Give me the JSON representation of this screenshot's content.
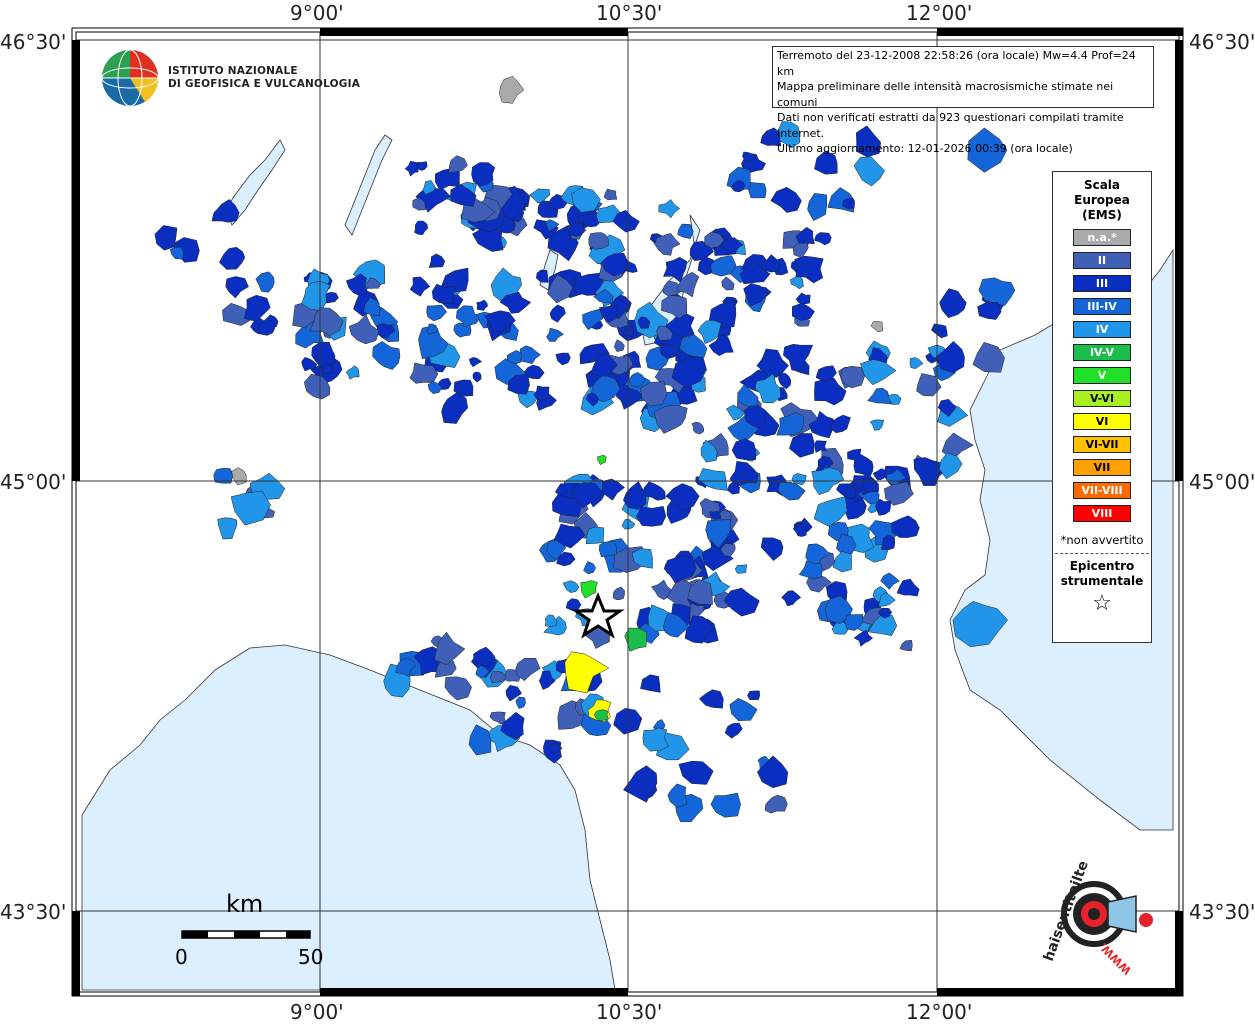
{
  "map": {
    "info_lines": [
      "Terremoto del 23-12-2008 22:58:26 (ora locale) Mw=4.4 Prof=24 km",
      "Mappa preliminare delle intensità macrosismiche stimate nei comuni",
      "Dati non verificati estratti da 923 questionari compilati tramite Internet.",
      "Ultimo aggiornamento: 12-01-2026 00:39 (ora locale)"
    ],
    "logo": {
      "line1": "ISTITUTO NAZIONALE",
      "line2": "DI GEOFISICA E VULCANOLOGIA"
    },
    "ticks": {
      "top": [
        "9°00'",
        "10°30'",
        "12°00'"
      ],
      "bottom": [
        "9°00'",
        "10°30'",
        "12°00'"
      ],
      "left": [
        "46°30'",
        "45°00'",
        "43°30'"
      ],
      "right": [
        "46°30'",
        "45°00'",
        "43°30'"
      ]
    },
    "scale": {
      "unit": "km",
      "start": "0",
      "end": "50"
    },
    "legend": {
      "title_lines": [
        "Scala",
        "Europea",
        "(EMS)"
      ],
      "classes": [
        {
          "label": "n.a.*",
          "color": "#aaaaaa"
        },
        {
          "label": "II",
          "color": "#4060b8"
        },
        {
          "label": "III",
          "color": "#0a2fc0"
        },
        {
          "label": "III-IV",
          "color": "#1466d8"
        },
        {
          "label": "IV",
          "color": "#2196e8"
        },
        {
          "label": "IV-V",
          "color": "#1bbe4a"
        },
        {
          "label": "V",
          "color": "#22e02a"
        },
        {
          "label": "V-VI",
          "color": "#a8f020"
        },
        {
          "label": "VI",
          "color": "#ffff00"
        },
        {
          "label": "VI-VII",
          "color": "#ffc000"
        },
        {
          "label": "VII",
          "color": "#ffa000"
        },
        {
          "label": "VII-VIII",
          "color": "#ff6a00"
        },
        {
          "label": "VIII",
          "color": "#ff0000"
        }
      ],
      "not_felt_note": "*non avvertito",
      "epicenter_lines": [
        "Epicentro",
        "strumentale"
      ]
    },
    "watermark": {
      "text": "haisentitoilterremoto.it",
      "site": "WWW."
    },
    "colors": {
      "sea": "#dcefff",
      "land": "#ffffff",
      "grid": "#333333",
      "frame": "#000000"
    }
  }
}
